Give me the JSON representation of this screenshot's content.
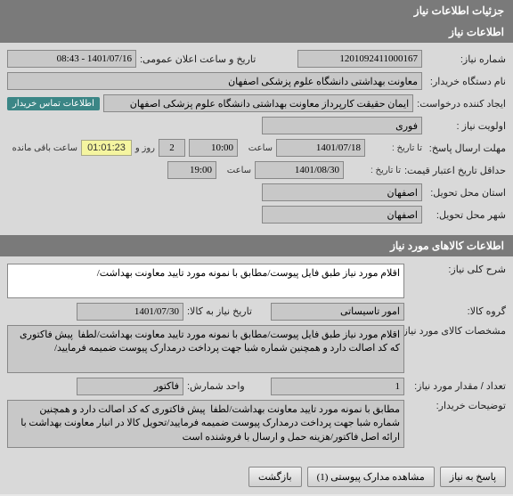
{
  "section1": {
    "title": "جزئیات اطلاعات نیاز"
  },
  "section2": {
    "title": "اطلاعات نیاز"
  },
  "need": {
    "number_label": "شماره نیاز:",
    "number": "1201092411000167",
    "announce_label": "تاریخ و ساعت اعلان عمومی:",
    "announce": "1401/07/16 - 08:43",
    "dept_label": "نام دستگاه خریدار:",
    "dept": "معاونت بهداشتی دانشگاه علوم پزشکی اصفهان",
    "creator_label": "ایجاد کننده درخواست:",
    "creator": "ایمان حقیقت کارپرداز معاونت بهداشتی دانشگاه علوم پزشکی اصفهان",
    "contact_badge": "اطلاعات تماس خریدار",
    "priority_label": "اولویت نیاز :",
    "priority": "فوری",
    "deadline_label": "مهلت ارسال پاسخ:",
    "until_label": "تا تاریخ :",
    "deadline_date": "1401/07/18",
    "time_label": "ساعت",
    "deadline_time": "10:00",
    "days": "2",
    "days_label": "روز و",
    "countdown": "01:01:23",
    "remaining_label": "ساعت باقی مانده",
    "validity_label": "حداقل تاریخ اعتبار قیمت:",
    "validity_date": "1401/08/30",
    "validity_time": "19:00",
    "province_label": "استان محل تحویل:",
    "province": "اصفهان",
    "city_label": "شهر محل تحویل:",
    "city": "اصفهان"
  },
  "section3": {
    "title": "اطلاعات کالاهای مورد نیاز"
  },
  "goods": {
    "desc_label": "شرح کلی نیاز:",
    "desc": "اقلام مورد نیاز طبق فایل پیوست/مطابق با نمونه مورد تایید معاونت بهداشت/",
    "group_label": "گروه کالا:",
    "group": "امور تاسیساتی",
    "date_need_label": "تاریخ نیاز به کالا:",
    "date_need": "1401/07/30",
    "spec_label": "مشخصات کالای مورد نیاز:",
    "spec": "اقلام مورد نیاز طبق فایل پیوست/مطابق با نمونه مورد تایید معاونت بهداشت/لطفا  پیش فاکتوری که کد اصالت دارد و همچنین شماره شبا جهت پرداخت درمدارک پیوست ضمیمه فرمایید/",
    "qty_label": "تعداد / مقدار مورد نیاز:",
    "qty": "1",
    "unit_label": "واحد شمارش:",
    "unit": "فاکتور",
    "notes_label": "توضیحات خریدار:",
    "notes": "مطابق با نمونه مورد تایید معاونت بهداشت/لطفا  پیش فاکتوری که کد اصالت دارد و همچنین شماره شبا جهت پرداخت درمدارک پیوست ضمیمه فرمایید/تحویل کالا در انبار معاونت بهداشت با ارائه اصل فاکتور/هزینه حمل و ارسال با فروشنده است"
  },
  "buttons": {
    "reply": "پاسخ به نیاز",
    "attachments": "مشاهده مدارک پیوستی (1)",
    "back": "بازگشت"
  }
}
